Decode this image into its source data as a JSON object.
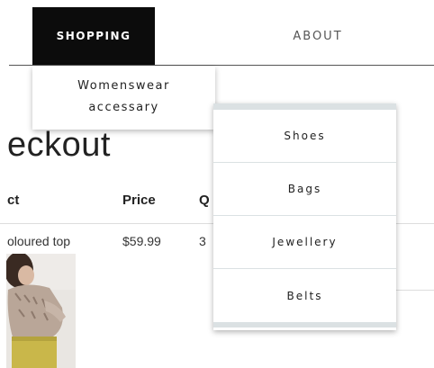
{
  "nav": {
    "items": [
      {
        "label": "SHOPPING"
      },
      {
        "label": "ABOUT"
      }
    ],
    "accent_bg": "#0c0c0c"
  },
  "dropdown": {
    "items": [
      {
        "label": "Womenswear"
      },
      {
        "label": "accessary"
      }
    ]
  },
  "submenu": {
    "items": [
      {
        "label": "Shoes"
      },
      {
        "label": "Bags"
      },
      {
        "label": "Jewellery"
      },
      {
        "label": "Belts"
      }
    ]
  },
  "page": {
    "heading": "eckout"
  },
  "table": {
    "headers": [
      "ct",
      "Price",
      "Q"
    ],
    "rows": [
      {
        "product": "oloured top",
        "price": "$59.99",
        "qty": "3"
      }
    ]
  }
}
